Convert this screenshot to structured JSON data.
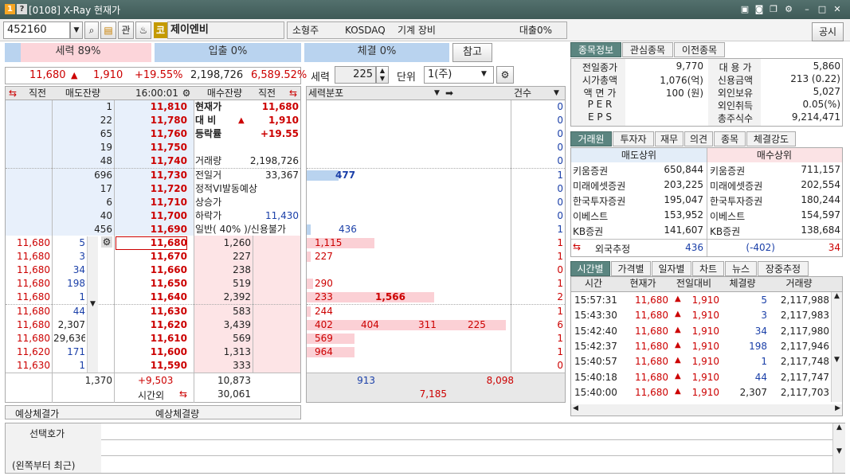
{
  "window": {
    "badge1": "1",
    "badge2": "?",
    "title": "[0108] X-Ray 현재가",
    "pin_icon": "pin-icon",
    "min_label": "–",
    "max_label": "□",
    "close_label": "✕"
  },
  "toolbar": {
    "code": "452160",
    "kwan": "관",
    "market_badge": "코",
    "name": "제이엔비",
    "category": "소형주",
    "market": "KOSDAQ",
    "sector": "기계 장비",
    "loan": "대출0%",
    "notice": "공시"
  },
  "strength": {
    "label": "세력 89%",
    "inflow": "입출 0%",
    "exec": "체결 0%",
    "ref": "참고"
  },
  "price_line": {
    "price": "11,680",
    "arrow": "▲",
    "change": "1,910",
    "rate": "+19.55%",
    "volume": "2,198,726",
    "turnover": "6,589.52%"
  },
  "controls": {
    "seryeok_label": "세력",
    "seryeok_val": "225",
    "unit_label": "단위",
    "unit_val": "1(주)"
  },
  "orderbook": {
    "headers": {
      "recent": "직전",
      "sell_rem": "매도잔량",
      "time": "16:00:01",
      "buy_rem": "매수잔량",
      "recent2": "직전"
    },
    "asks": [
      {
        "qty": "1",
        "price": "11,810"
      },
      {
        "qty": "22",
        "price": "11,780"
      },
      {
        "qty": "65",
        "price": "11,760"
      },
      {
        "qty": "19",
        "price": "11,750"
      },
      {
        "qty": "48",
        "price": "11,740"
      },
      {
        "qty": "696",
        "price": "11,730"
      },
      {
        "qty": "17",
        "price": "11,720"
      },
      {
        "qty": "6",
        "price": "11,710"
      },
      {
        "qty": "40",
        "price": "11,700"
      },
      {
        "qty": "456",
        "price": "11,690"
      }
    ],
    "bids": [
      {
        "price": "11,680",
        "qty": "1,260"
      },
      {
        "price": "11,670",
        "qty": "227"
      },
      {
        "price": "11,660",
        "qty": "238"
      },
      {
        "price": "11,650",
        "qty": "519"
      },
      {
        "price": "11,640",
        "qty": "2,392"
      },
      {
        "price": "11,630",
        "qty": "583"
      },
      {
        "price": "11,620",
        "qty": "3,439"
      },
      {
        "price": "11,610",
        "qty": "569"
      },
      {
        "price": "11,600",
        "qty": "1,313"
      },
      {
        "price": "11,590",
        "qty": "333"
      }
    ],
    "ticks": [
      {
        "p": "11,680",
        "q": "5"
      },
      {
        "p": "11,680",
        "q": "3"
      },
      {
        "p": "11,680",
        "q": "34"
      },
      {
        "p": "11,680",
        "q": "198"
      },
      {
        "p": "11,680",
        "q": "1"
      },
      {
        "p": "11,680",
        "q": "44"
      },
      {
        "p": "11,680",
        "q": "2,307"
      },
      {
        "p": "11,680",
        "q": "29,636"
      },
      {
        "p": "11,620",
        "q": "171"
      },
      {
        "p": "11,630",
        "q": "1"
      }
    ],
    "info": [
      {
        "k": "현재가",
        "v": "11,680"
      },
      {
        "k": "대 비",
        "v": "1,910",
        "arrow": "▲"
      },
      {
        "k": "등락률",
        "v": "+19.55"
      },
      {
        "k": "",
        "v": ""
      },
      {
        "k": "거래량",
        "v": "2,198,726"
      },
      {
        "k": "전일거",
        "v": "33,367"
      },
      {
        "k": "정적VI발동예상",
        "v": ""
      },
      {
        "k": "상승가",
        "v": ""
      },
      {
        "k": "하락가",
        "v": "11,430"
      },
      {
        "k": "일반( 40% )/신용불가",
        "v": ""
      }
    ],
    "total_sell": "1,370",
    "total_diff": "+9,503",
    "total_buy": "10,873",
    "afterhours_label": "시간외",
    "afterhours": "30,061"
  },
  "dist": {
    "header": "세력분포",
    "count": "건수",
    "ask_vals": [
      {
        "i": 5,
        "v": "477",
        "w": 40
      }
    ],
    "ask_counts": [
      "0",
      "0",
      "0",
      "0",
      "0",
      "1",
      "0",
      "0",
      "0",
      "1"
    ],
    "ask_low": [
      {
        "i": 9,
        "v": "436",
        "w": 5
      }
    ],
    "bid_rows": [
      {
        "vals": [
          "1,115"
        ],
        "w": [
          85
        ],
        "c": "1"
      },
      {
        "vals": [
          "227"
        ],
        "w": [
          5
        ],
        "c": "1"
      },
      {
        "vals": [],
        "w": [],
        "c": "0"
      },
      {
        "vals": [
          "290"
        ],
        "w": [
          8
        ],
        "c": "1"
      },
      {
        "vals": [
          "233",
          "1,566"
        ],
        "w": [
          160
        ],
        "c": "2"
      },
      {
        "vals": [
          "244"
        ],
        "w": [
          5
        ],
        "c": "1"
      },
      {
        "vals": [
          "402",
          "404",
          "311",
          "225"
        ],
        "w": [
          250
        ],
        "c": "6"
      },
      {
        "vals": [
          "569"
        ],
        "w": [
          60
        ],
        "c": "1"
      },
      {
        "vals": [
          "964"
        ],
        "w": [
          60
        ],
        "c": "1"
      },
      {
        "vals": [],
        "w": [],
        "c": "0"
      }
    ],
    "sum_blue": "913",
    "sum_red": "8,098",
    "sum_red2": "7,185"
  },
  "predict": {
    "label1": "예상체결가",
    "label2": "예상체결량"
  },
  "bottom": {
    "label1": "선택호가",
    "label2": "(왼쪽부터 최근)"
  },
  "right_tabs1": [
    "종목정보",
    "관심종목",
    "이전종목"
  ],
  "stockinfo": [
    {
      "k": "전일종가",
      "v": "9,770",
      "k2": "대 용 가",
      "v2": "5,860"
    },
    {
      "k": "시가총액",
      "v": "1,076(억)",
      "k2": "신용금액",
      "v2": "213  (0.22)"
    },
    {
      "k": "액 면 가",
      "v": "100 (원)",
      "k2": "외인보유",
      "v2": "5,027"
    },
    {
      "k": "P E R",
      "v": "",
      "k2": "외인취득",
      "v2": "0.05(%)"
    },
    {
      "k": "E P S",
      "v": "",
      "k2": "총주식수",
      "v2": "9,214,471"
    }
  ],
  "right_tabs2": [
    "거래원",
    "투자자",
    "재무",
    "의견",
    "종목",
    "체결강도"
  ],
  "brokers": {
    "sell_h": "매도상위",
    "buy_h": "매수상위",
    "rows": [
      {
        "s": "키움증권",
        "sv": "650,844",
        "b": "키움증권",
        "bv": "711,157"
      },
      {
        "s": "미래에셋증권",
        "sv": "203,225",
        "b": "미래에셋증권",
        "bv": "202,554"
      },
      {
        "s": "한국투자증권",
        "sv": "195,047",
        "b": "한국투자증권",
        "bv": "180,244"
      },
      {
        "s": "이베스트",
        "sv": "153,952",
        "b": "이베스트",
        "bv": "154,597"
      },
      {
        "s": "KB증권",
        "sv": "141,607",
        "b": "KB증권",
        "bv": "138,684"
      }
    ],
    "foreign_label": "외국추정",
    "foreign_sell": "436",
    "foreign_net": "(-402)",
    "foreign_buy": "34"
  },
  "right_tabs3": [
    "시간별",
    "가격별",
    "일자별",
    "차트",
    "뉴스",
    "장중추정"
  ],
  "timetbl": {
    "headers": [
      "시간",
      "현재가",
      "전일대비",
      "체결량",
      "거래량"
    ],
    "rows": [
      {
        "t": "15:57:31",
        "p": "11,680",
        "d": "1,910",
        "q": "5",
        "v": "2,117,988"
      },
      {
        "t": "15:43:30",
        "p": "11,680",
        "d": "1,910",
        "q": "3",
        "v": "2,117,983"
      },
      {
        "t": "15:42:40",
        "p": "11,680",
        "d": "1,910",
        "q": "34",
        "v": "2,117,980"
      },
      {
        "t": "15:42:37",
        "p": "11,680",
        "d": "1,910",
        "q": "198",
        "v": "2,117,946"
      },
      {
        "t": "15:40:57",
        "p": "11,680",
        "d": "1,910",
        "q": "1",
        "v": "2,117,748"
      },
      {
        "t": "15:40:18",
        "p": "11,680",
        "d": "1,910",
        "q": "44",
        "v": "2,117,747"
      },
      {
        "t": "15:40:00",
        "p": "11,680",
        "d": "1,910",
        "q": "2,307",
        "v": "2,117,703"
      }
    ]
  }
}
